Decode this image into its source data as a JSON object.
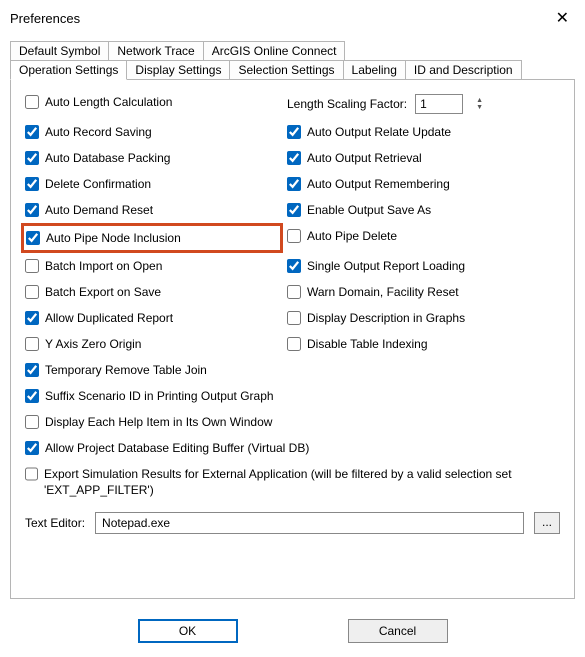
{
  "window": {
    "title": "Preferences",
    "close_glyph": "✕"
  },
  "tabs": {
    "row1": [
      {
        "label": "Default Symbol"
      },
      {
        "label": "Network Trace"
      },
      {
        "label": "ArcGIS Online Connect"
      }
    ],
    "row2": [
      {
        "label": "Operation Settings",
        "active": true
      },
      {
        "label": "Display Settings"
      },
      {
        "label": "Selection Settings"
      },
      {
        "label": "Labeling"
      },
      {
        "label": "ID and Description"
      }
    ]
  },
  "scaling": {
    "label": "Length Scaling Factor:",
    "value": "1"
  },
  "left": [
    {
      "label": "Auto Length Calculation",
      "checked": false
    },
    {
      "label": "Auto Record Saving",
      "checked": true
    },
    {
      "label": "Auto Database Packing",
      "checked": true
    },
    {
      "label": "Delete Confirmation",
      "checked": true
    },
    {
      "label": "Auto Demand Reset",
      "checked": true
    },
    {
      "label": "Auto Pipe Node Inclusion",
      "checked": true,
      "highlight": true
    },
    {
      "label": "Batch Import on Open",
      "checked": false
    },
    {
      "label": "Batch Export on Save",
      "checked": false
    },
    {
      "label": "Allow Duplicated Report",
      "checked": true
    },
    {
      "label": "Y Axis Zero Origin",
      "checked": false
    }
  ],
  "right": [
    {
      "label": "Auto Output Relate Update",
      "checked": true
    },
    {
      "label": "Auto Output Retrieval",
      "checked": true
    },
    {
      "label": "Auto Output Remembering",
      "checked": true
    },
    {
      "label": "Enable Output Save As",
      "checked": true
    },
    {
      "label": "Auto Pipe Delete",
      "checked": false
    },
    {
      "label": "Single Output Report Loading",
      "checked": true
    },
    {
      "label": "Warn Domain, Facility Reset",
      "checked": false
    },
    {
      "label": "Display Description in Graphs",
      "checked": false
    },
    {
      "label": "Disable Table Indexing",
      "checked": false
    }
  ],
  "full": [
    {
      "label": "Temporary Remove Table Join",
      "checked": true
    },
    {
      "label": "Suffix Scenario ID in Printing Output Graph",
      "checked": true
    },
    {
      "label": "Display Each Help Item in Its Own Window",
      "checked": false
    },
    {
      "label": "Allow Project Database Editing Buffer (Virtual DB)",
      "checked": true
    },
    {
      "label": "Export Simulation Results for External Application (will be filtered by a valid selection set 'EXT_APP_FILTER')",
      "checked": false
    }
  ],
  "editor": {
    "label": "Text Editor:",
    "value": "Notepad.exe",
    "browse": "..."
  },
  "buttons": {
    "ok": "OK",
    "cancel": "Cancel"
  }
}
